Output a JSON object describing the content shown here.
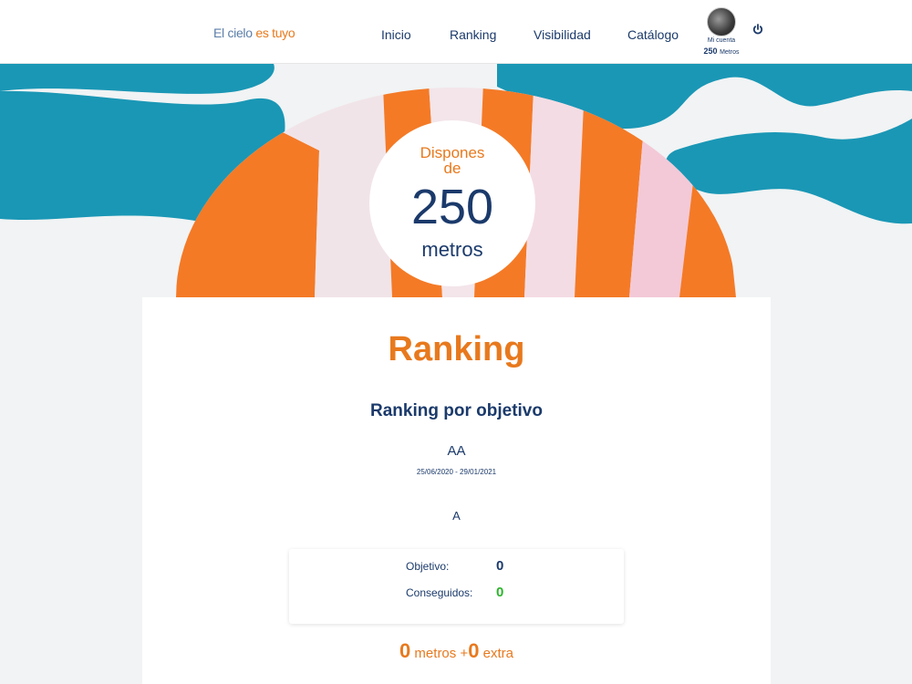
{
  "header": {
    "logo_part1": "El cielo ",
    "logo_part2": "es tuyo",
    "nav": [
      "Inicio",
      "Ranking",
      "Visibilidad",
      "Catálogo"
    ],
    "account_label": "Mi cuenta",
    "account_meters_value": "250",
    "account_meters_unit": "Metros"
  },
  "hero": {
    "line1": "Dispones",
    "line2": "de",
    "value": "250",
    "unit": "metros"
  },
  "main": {
    "title": "Ranking",
    "subtitle": "Ranking por objetivo",
    "objective_name": "AA",
    "objective_dates": "25/06/2020 - 29/01/2021",
    "objective_level": "A",
    "objective_label": "Objetivo:",
    "objective_value": "0",
    "achieved_label": "Conseguidos:",
    "achieved_value": "0",
    "result_meters": "0",
    "result_meters_label": " metros +",
    "result_extra": "0",
    "result_extra_label": " extra"
  },
  "colors": {
    "orange": "#e8791d",
    "navy": "#1b3a6b",
    "teal": "#1a97b5",
    "green": "#2db32d"
  },
  "icons": {
    "power": "power-icon",
    "avatar": "avatar"
  }
}
